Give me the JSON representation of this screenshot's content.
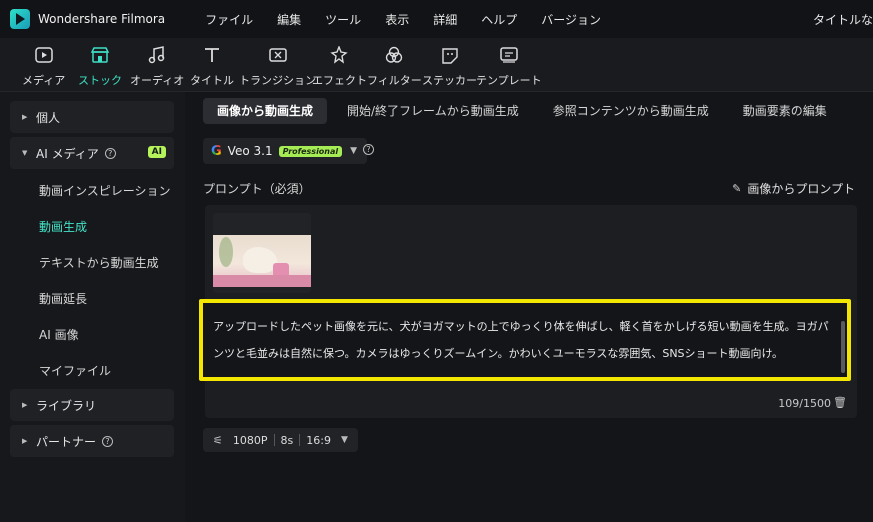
{
  "app": {
    "name": "Wondershare Filmora",
    "title_right": "タイトルな"
  },
  "menu": [
    "ファイル",
    "編集",
    "ツール",
    "表示",
    "詳細",
    "ヘルプ",
    "バージョン"
  ],
  "toolbar": [
    {
      "label": "メディア",
      "icon": "media-icon"
    },
    {
      "label": "ストック",
      "icon": "stock-icon",
      "active": true
    },
    {
      "label": "オーディオ",
      "icon": "audio-icon"
    },
    {
      "label": "タイトル",
      "icon": "title-icon"
    },
    {
      "label": "トランジション",
      "icon": "transition-icon"
    },
    {
      "label": "エフェクト",
      "icon": "effect-icon"
    },
    {
      "label": "フィルター",
      "icon": "filter-icon"
    },
    {
      "label": "ステッカー",
      "icon": "sticker-icon"
    },
    {
      "label": "テンプレート",
      "icon": "template-icon"
    }
  ],
  "sidebar": {
    "personal": "個人",
    "ai_media": "AI メディア",
    "ai_badge": "AI",
    "items": [
      "動画インスピレーション",
      "動画生成",
      "テキストから動画生成",
      "動画延長",
      "AI 画像",
      "マイファイル"
    ],
    "active_item": "動画生成",
    "library": "ライブラリ",
    "partner": "パートナー"
  },
  "tabs": [
    "画像から動画生成",
    "開始/終了フレームから動画生成",
    "参照コンテンツから動画生成",
    "動画要素の編集"
  ],
  "model": {
    "google_glyph": "G",
    "name": "Veo 3.1",
    "badge": "Professional",
    "help": "?"
  },
  "prompt": {
    "label": "プロンプト（必須）",
    "image_to_prompt": "画像からプロンプト",
    "text": "アップロードしたペット画像を元に、犬がヨガマットの上でゆっくり体を伸ばし、軽く首をかしげる短い動画を生成。ヨガパンツと毛並みは自然に保つ。カメラはゆっくりズームイン。かわいくユーモラスな雰囲気、SNSショート動画向け。",
    "counter": "109/1500"
  },
  "settings": {
    "resolution": "1080P",
    "duration": "8s",
    "aspect": "16:9"
  },
  "colors": {
    "accent": "#3ee0c5",
    "highlight_border": "#f3e600",
    "badge": "#a6ec55"
  }
}
